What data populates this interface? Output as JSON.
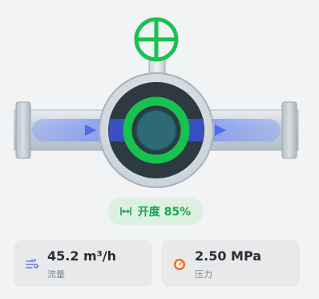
{
  "valve": {
    "handle_icon": "valve-handwheel-icon",
    "flow_direction_icon": "arrow-right-icon",
    "state": "open",
    "opening_percent": 85
  },
  "opening_badge": {
    "icon": "width-arrows-icon",
    "text": "开度 85%"
  },
  "flow_card": {
    "icon": "wind-icon",
    "value": "45.2 m³/h",
    "label": "流量"
  },
  "pressure_card": {
    "icon": "gauge-icon",
    "value": "2.50 MPa",
    "label": "压力"
  },
  "colors": {
    "active_green": "#17c24f",
    "flow_blue": "#6e83f0",
    "pipe_gray": "#c9d2d9",
    "valve_dark": "#2d3a42",
    "valve_core": "#2e6a73",
    "gauge_orange": "#f06a1d"
  }
}
